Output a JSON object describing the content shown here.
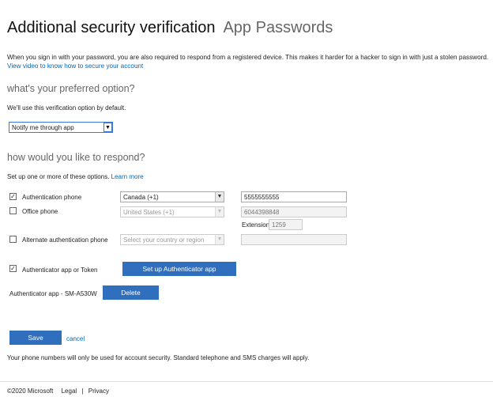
{
  "header": {
    "title": "Additional security verification",
    "subtitle": "App Passwords"
  },
  "intro": {
    "text": "When you sign in with your password, you are also required to respond from a registered device. This makes it harder for a hacker to sign in with just a stolen password.",
    "video_link": "View video to know how to secure your account"
  },
  "preferred": {
    "heading": "what's your preferred option?",
    "note": "We'll use this verification option by default.",
    "selected": "Notify me through app"
  },
  "respond": {
    "heading": "how would you like to respond?",
    "note": "Set up one or more of these options.",
    "learn_more": "Learn more",
    "auth_phone": {
      "label": "Authentication phone",
      "checked": true,
      "country": "Canada (+1)",
      "number": "5555555555"
    },
    "office_phone": {
      "label": "Office phone",
      "checked": false,
      "country": "United States (+1)",
      "number": "6044398848",
      "extension_label": "Extension",
      "extension": "1259"
    },
    "alt_phone": {
      "label": "Alternate authentication phone",
      "checked": false,
      "country_placeholder": "Select your country or region",
      "number": ""
    },
    "authenticator": {
      "label": "Authenticator app or Token",
      "checked": true,
      "setup_button": "Set up Authenticator app",
      "device_label": "Authenticator app - SM-A530W",
      "delete_button": "Delete"
    }
  },
  "actions": {
    "save": "Save",
    "cancel": "cancel"
  },
  "disclaimer": "Your phone numbers will only be used for account security. Standard telephone and SMS charges will apply.",
  "footer": {
    "copyright": "©2020 Microsoft",
    "legal": "Legal",
    "separator": "|",
    "privacy": "Privacy"
  },
  "icons": {
    "check": "check-icon",
    "dropdown": "chevron-down-icon"
  },
  "colors": {
    "primary": "#2f6fbd",
    "link": "#0067b8",
    "heading_gray": "#666666"
  }
}
